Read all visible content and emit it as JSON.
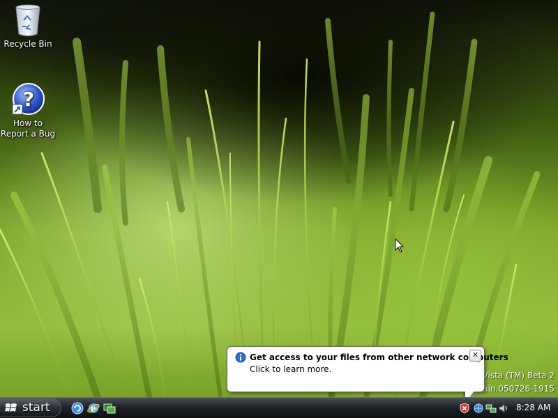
{
  "desktop": {
    "icons": [
      {
        "label": "Recycle Bin",
        "icon": "recycle-bin-icon"
      },
      {
        "label": "How to Report a Bug",
        "label_line1": "How to",
        "label_line2": "Report a Bug",
        "icon": "help-question-icon"
      }
    ]
  },
  "balloon": {
    "title": "Get access to your files from other network computers",
    "body": "Click to learn more.",
    "close_label": "✕",
    "icon": "info-icon"
  },
  "watermark": {
    "line1": "s Vista (TM) Beta 2",
    "line2": "nain.050726-1915"
  },
  "taskbar": {
    "start_label": "start",
    "quick_launch": [
      {
        "name": "show-desktop-icon"
      },
      {
        "name": "internet-explorer-icon"
      },
      {
        "name": "switch-windows-icon"
      }
    ],
    "tray": {
      "icons": [
        "security-alert-icon",
        "network-icon",
        "network-activity-icon",
        "volume-icon"
      ],
      "clock": "8:28 AM"
    }
  },
  "colors": {
    "taskbar_dark": "#0d1012",
    "grass_green": "#94bd3c",
    "balloon_bg": "#ffffff"
  }
}
